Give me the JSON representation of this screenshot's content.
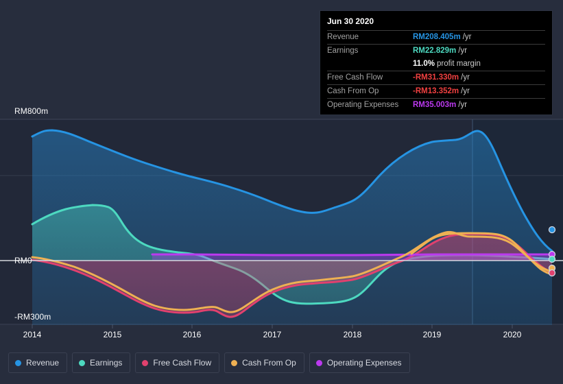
{
  "colors": {
    "background": "#272d3d",
    "plot_background": "#222838",
    "plot_background_forecast": "#1b2536",
    "zero_line": "#d5d8de",
    "grid": "#3a4052",
    "revenue": "#2694e3",
    "earnings": "#4dd9c0",
    "free_cash_flow": "#e1416e",
    "cash_from_op": "#eeb053",
    "operating_expenses": "#bb39ef",
    "tooltip_bg": "#000000",
    "text": "#ffffff",
    "muted_text": "#a2a2a2"
  },
  "tooltip": {
    "date": "Jun 30 2020",
    "rows": [
      {
        "key": "Revenue",
        "value": "RM208.405m",
        "unit": "/yr",
        "color": "#2694e3"
      },
      {
        "key": "Earnings",
        "value": "RM22.829m",
        "unit": "/yr",
        "color": "#4dd9c0"
      },
      {
        "key": "",
        "value": "11.0%",
        "unit": "profit margin",
        "color": "#ffffff"
      },
      {
        "key": "Free Cash Flow",
        "value": "-RM31.330m",
        "unit": "/yr",
        "color": "#f04040"
      },
      {
        "key": "Cash From Op",
        "value": "-RM13.352m",
        "unit": "/yr",
        "color": "#f04040"
      },
      {
        "key": "Operating Expenses",
        "value": "RM35.003m",
        "unit": "/yr",
        "color": "#bb39ef"
      }
    ]
  },
  "legend": {
    "items": [
      {
        "label": "Revenue",
        "color": "#2694e3"
      },
      {
        "label": "Earnings",
        "color": "#4dd9c0"
      },
      {
        "label": "Free Cash Flow",
        "color": "#e1416e"
      },
      {
        "label": "Cash From Op",
        "color": "#eeb053"
      },
      {
        "label": "Operating Expenses",
        "color": "#bb39ef"
      }
    ]
  },
  "axis": {
    "y_top_label": "RM800m",
    "y_zero_label": "RM0",
    "y_bottom_label": "-RM300m",
    "x_labels": [
      "2014",
      "2015",
      "2016",
      "2017",
      "2018",
      "2019",
      "2020"
    ]
  },
  "chart_data": {
    "type": "area",
    "title": "",
    "xlabel": "",
    "ylabel": "RM",
    "ylim": [
      -300,
      800
    ],
    "xlim": [
      2014,
      2020.6
    ],
    "grid": true,
    "legend_position": "bottom",
    "y_ticks": [
      800,
      500,
      0,
      -300
    ],
    "y_tick_labels": [
      "RM800m",
      "",
      "RM0",
      "-RM300m"
    ],
    "x_ticks": [
      2014,
      2015,
      2016,
      2017,
      2018,
      2019,
      2020
    ],
    "x": [
      2014.0,
      2014.25,
      2014.5,
      2014.75,
      2015.0,
      2015.25,
      2015.5,
      2015.75,
      2016.0,
      2016.25,
      2016.5,
      2016.75,
      2017.0,
      2017.25,
      2017.5,
      2017.75,
      2018.0,
      2018.25,
      2018.5,
      2018.75,
      2019.0,
      2019.25,
      2019.5,
      2019.75,
      2020.0,
      2020.25,
      2020.5
    ],
    "series": [
      {
        "name": "Revenue",
        "color": "#2694e3",
        "values": [
          703,
          722,
          716,
          700,
          668,
          646,
          628,
          608,
          588,
          570,
          548,
          530,
          514,
          498,
          505,
          512,
          500,
          508,
          528,
          572,
          612,
          618,
          622,
          648,
          600,
          480,
          208
        ]
      },
      {
        "name": "Earnings",
        "color": "#4dd9c0",
        "values": [
          205,
          248,
          280,
          308,
          318,
          302,
          250,
          200,
          162,
          152,
          148,
          145,
          132,
          110,
          80,
          40,
          -12,
          -75,
          -108,
          -112,
          -92,
          -20,
          48,
          72,
          70,
          60,
          23
        ]
      },
      {
        "name": "Free Cash Flow",
        "color": "#e1416e",
        "values": [
          5,
          -16,
          -48,
          -88,
          -128,
          -165,
          -190,
          -205,
          -210,
          -238,
          -215,
          -178,
          -148,
          -128,
          -118,
          -102,
          -86,
          -60,
          -46,
          -40,
          -30,
          45,
          108,
          112,
          96,
          30,
          -31
        ]
      },
      {
        "name": "Cash From Op",
        "color": "#eeb053",
        "values": [
          20,
          2,
          -30,
          -68,
          -110,
          -148,
          -175,
          -190,
          -196,
          -188,
          -178,
          -148,
          -120,
          -100,
          -88,
          -72,
          -58,
          -36,
          -24,
          -18,
          -6,
          70,
          135,
          140,
          124,
          52,
          -13
        ]
      },
      {
        "name": "Operating Expenses",
        "color": "#bb39ef",
        "values": [
          null,
          null,
          null,
          null,
          null,
          32,
          30,
          28,
          28,
          28,
          28,
          28,
          28,
          30,
          32,
          32,
          32,
          32,
          32,
          32,
          32,
          33,
          34,
          35,
          36,
          36,
          35
        ]
      }
    ]
  }
}
